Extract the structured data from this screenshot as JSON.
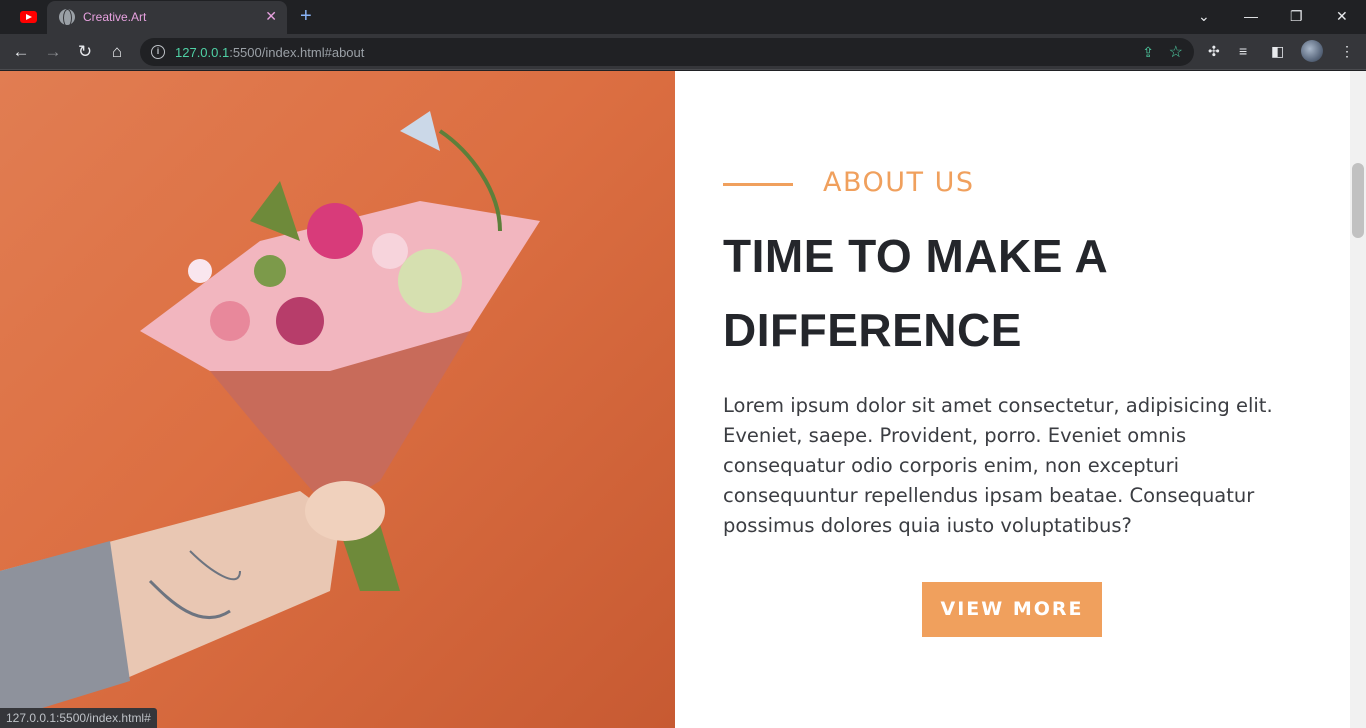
{
  "browser": {
    "tabs": [
      {
        "title": "",
        "icon": "youtube-icon"
      },
      {
        "title": "Creative.Art",
        "icon": "globe-icon",
        "active": true
      }
    ],
    "address": {
      "host": "127.0.0.1",
      "rest": ":5500/index.html#about"
    },
    "status_url": "127.0.0.1:5500/index.html#"
  },
  "about": {
    "label": "ABOUT US",
    "headline": "TIME TO MAKE A DIFFERENCE",
    "body": "Lorem ipsum dolor sit amet consectetur, adipisicing elit. Eveniet, saepe. Provident, porro. Eveniet omnis consequatur odio corporis enim, non excepturi consequuntur repellendus ipsam beatae. Consequatur possimus dolores quia iusto voluptatibus?",
    "button": "VIEW MORE"
  },
  "colors": {
    "accent": "#f0a05d",
    "heading": "#24262b",
    "photo_bg": "#dc6f42"
  }
}
